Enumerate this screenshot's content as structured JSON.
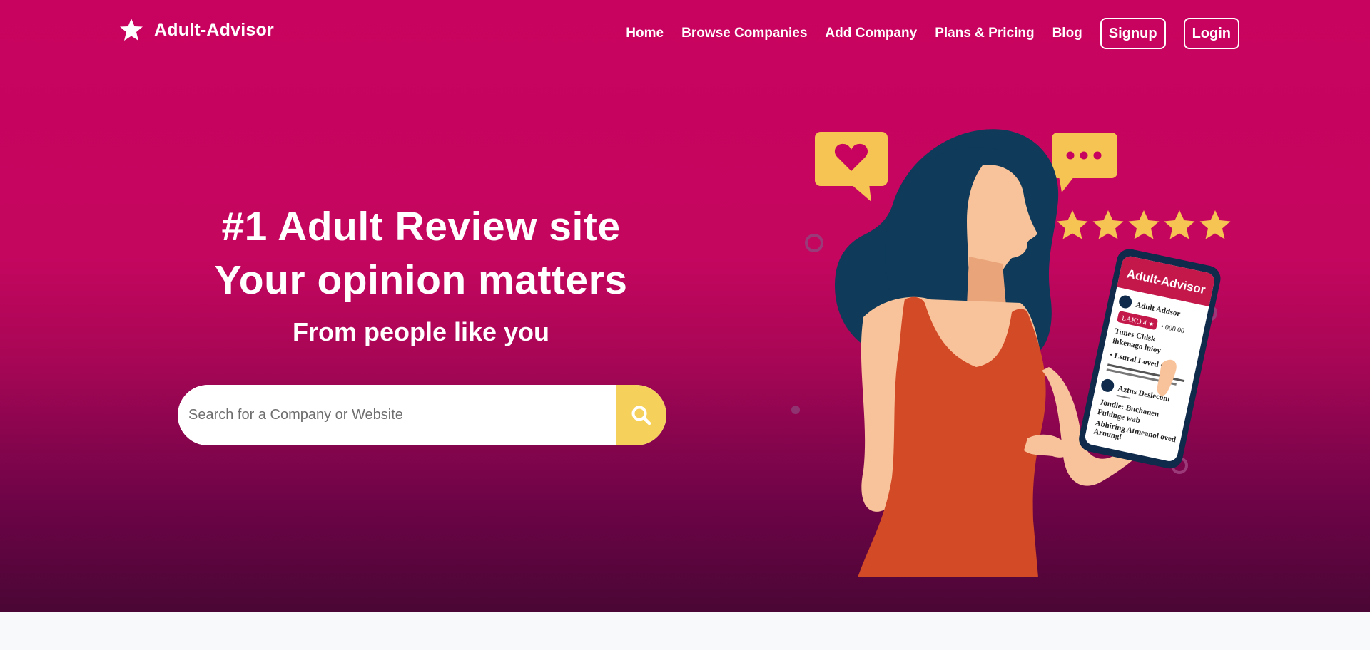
{
  "brand": {
    "name": "Adult-Advisor",
    "logo_icon": "star-icon"
  },
  "nav": {
    "links": [
      "Home",
      "Browse Companies",
      "Add Company",
      "Plans & Pricing",
      "Blog"
    ],
    "signup_label": "Signup",
    "login_label": "Login"
  },
  "hero": {
    "headline_line1": "#1 Adult Review site",
    "headline_line2": "Your opinion matters",
    "subheadline": "From people like you"
  },
  "search": {
    "placeholder": "Search for a Company or Website",
    "button_icon": "search-icon"
  },
  "illustration": {
    "phone_app_title": "Adult-Advisor",
    "phone_review_1_name": "Adult Addsor",
    "phone_review_1_badge": "LAKO 4 ★",
    "phone_review_1_meta": "• 000 00",
    "phone_review_1_lines": [
      "Tunes Chisk",
      "ihkenago lnioy",
      "• Lsural Loved •"
    ],
    "phone_review_2_name": "Aztus Deslecom",
    "phone_review_2_lines": [
      "Jondle: Buchanen",
      "Fuhinge wab",
      "Abhiring Atmeanol oved",
      "Arnung!"
    ],
    "stars_rating": 5,
    "colors": {
      "accent_yellow": "#f5c452",
      "hero_pink": "#c8035f",
      "hair": "#0f3a5a",
      "dress": "#d24a26"
    }
  },
  "colors": {
    "hero_top": "#c8035f",
    "hero_bottom": "#4a0635",
    "search_button": "#f5d15b"
  }
}
